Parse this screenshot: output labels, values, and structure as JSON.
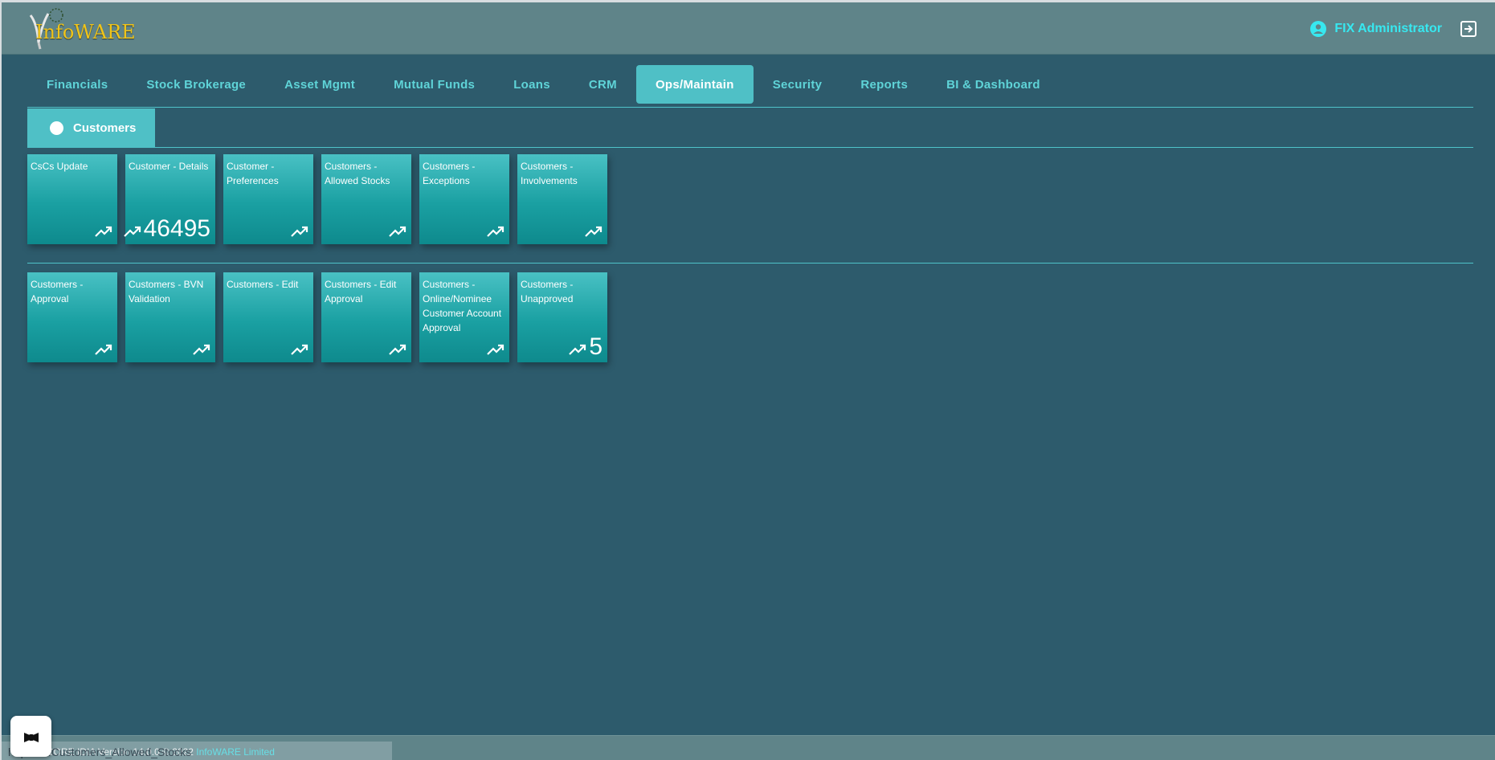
{
  "header": {
    "logo_text": "InfoWARE",
    "user_name": "FIX Administrator",
    "colors": {
      "accent": "#37e8f0",
      "header_bg": "#5f8489",
      "page_bg": "#2d5b6c",
      "tile": "#1aa0a2"
    }
  },
  "nav": {
    "items": [
      {
        "label": "Financials"
      },
      {
        "label": "Stock Brokerage"
      },
      {
        "label": "Asset Mgmt"
      },
      {
        "label": "Mutual Funds"
      },
      {
        "label": "Loans"
      },
      {
        "label": "CRM"
      },
      {
        "label": "Ops/Maintain",
        "active": true
      },
      {
        "label": "Security"
      },
      {
        "label": "Reports"
      },
      {
        "label": "BI & Dashboard"
      }
    ]
  },
  "subtab": {
    "label": "Customers"
  },
  "tiles_row1": [
    {
      "label": "CsCs Update",
      "count": ""
    },
    {
      "label": "Customer - Details",
      "count": "46495"
    },
    {
      "label": "Customer - Preferences",
      "count": ""
    },
    {
      "label": "Customers - Allowed Stocks",
      "count": ""
    },
    {
      "label": "Customers - Exceptions",
      "count": ""
    },
    {
      "label": "Customers - Involvements",
      "count": ""
    }
  ],
  "tiles_row2": [
    {
      "label": "Customers - Approval",
      "count": ""
    },
    {
      "label": "Customers - BVN Validation",
      "count": ""
    },
    {
      "label": "Customers - Edit",
      "count": ""
    },
    {
      "label": "Customers - Edit Approval",
      "count": ""
    },
    {
      "label": "Customers - Online/Nominee Customer Account Approval",
      "count": ""
    },
    {
      "label": "Customers - Unapproved",
      "count": "5"
    }
  ],
  "footer": {
    "text": "CORE IDIA Version 14.0.0 © 2022",
    "link": "InfoWARE Limited",
    "status_url": "https://...Customers_Allowed_Stocks"
  }
}
